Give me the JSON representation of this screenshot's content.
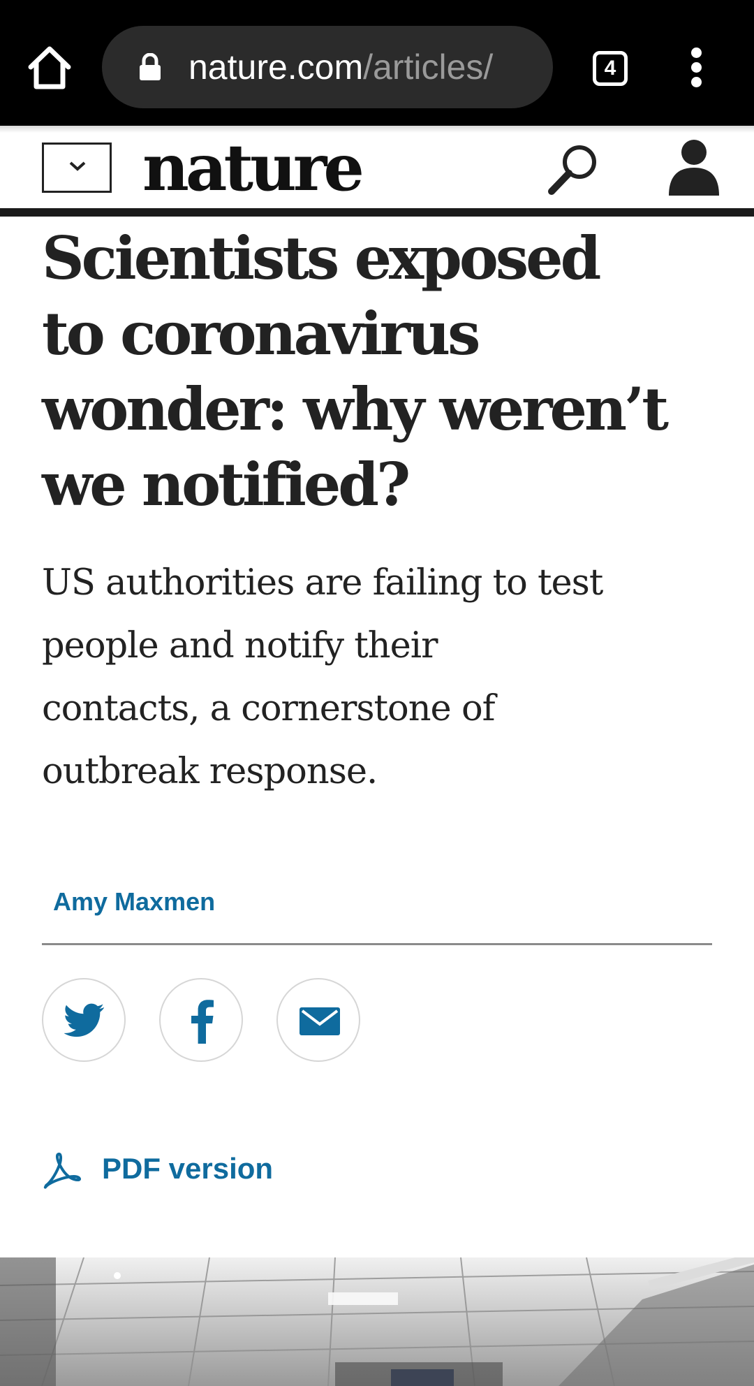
{
  "browser": {
    "url_domain": "nature.com",
    "url_path": "/articles/",
    "tab_count": "4"
  },
  "site": {
    "logo": "nature"
  },
  "article": {
    "headline_lines": [
      "Scientists exposed",
      "to coronavirus",
      "wonder: why weren’t",
      "we notified?"
    ],
    "standfirst_lines": [
      "US authorities are failing to test",
      "people and notify their",
      "contacts, a cornerstone of",
      "outbreak response."
    ],
    "author": "Amy Maxmen",
    "pdf_label": "PDF version"
  },
  "icons": {
    "home": "home-icon",
    "lock": "lock-icon",
    "menu": "more-vert-icon",
    "dropdown": "chevron-down-icon",
    "search": "search-icon",
    "account": "account-icon",
    "share": [
      "twitter-icon",
      "facebook-icon",
      "email-icon"
    ],
    "pdf": "acrobat-pdf-icon"
  },
  "colors": {
    "link_blue": "#0f6b9e",
    "text": "#222222",
    "browser_bar": "#000000"
  }
}
